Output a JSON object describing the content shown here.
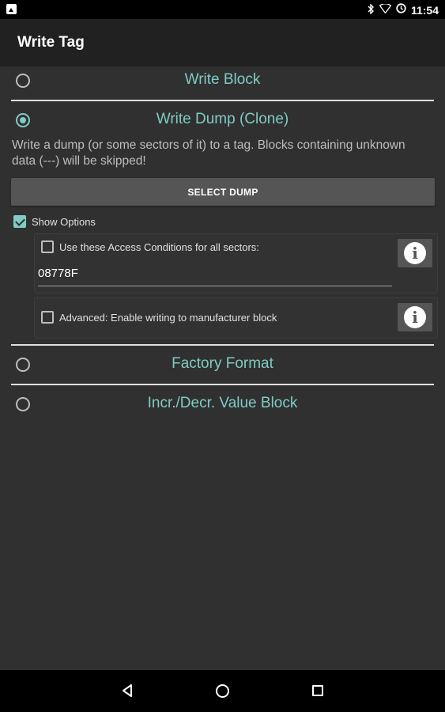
{
  "status_bar": {
    "time": "11:54",
    "icons": [
      "image-icon",
      "bluetooth-icon",
      "wifi-icon",
      "alarm-icon"
    ]
  },
  "toolbar": {
    "title": "Write Tag"
  },
  "sections": {
    "write_block": {
      "label": "Write Block",
      "selected": false
    },
    "write_dump": {
      "label": "Write Dump (Clone)",
      "selected": true
    },
    "factory_format": {
      "label": "Factory Format",
      "selected": false
    },
    "value_block": {
      "label": "Incr./Decr. Value Block",
      "selected": false
    }
  },
  "write_dump": {
    "description": "Write a dump (or some sectors of it) to a tag. Blocks containing unknown data (---) will be skipped!",
    "select_button": "SELECT DUMP",
    "show_options": {
      "label": "Show Options",
      "checked": true
    },
    "access_conditions": {
      "label": "Use these Access Conditions for all sectors:",
      "checked": false,
      "value": "08778F"
    },
    "advanced": {
      "label": "Advanced: Enable writing to manufacturer block",
      "checked": false
    },
    "info_glyph": "i"
  },
  "colors": {
    "accent": "#80cbc4",
    "background": "#303030",
    "toolbar": "#212121",
    "button": "#555555"
  },
  "navigation": {
    "icons": [
      "back-icon",
      "home-icon",
      "recents-icon"
    ]
  }
}
